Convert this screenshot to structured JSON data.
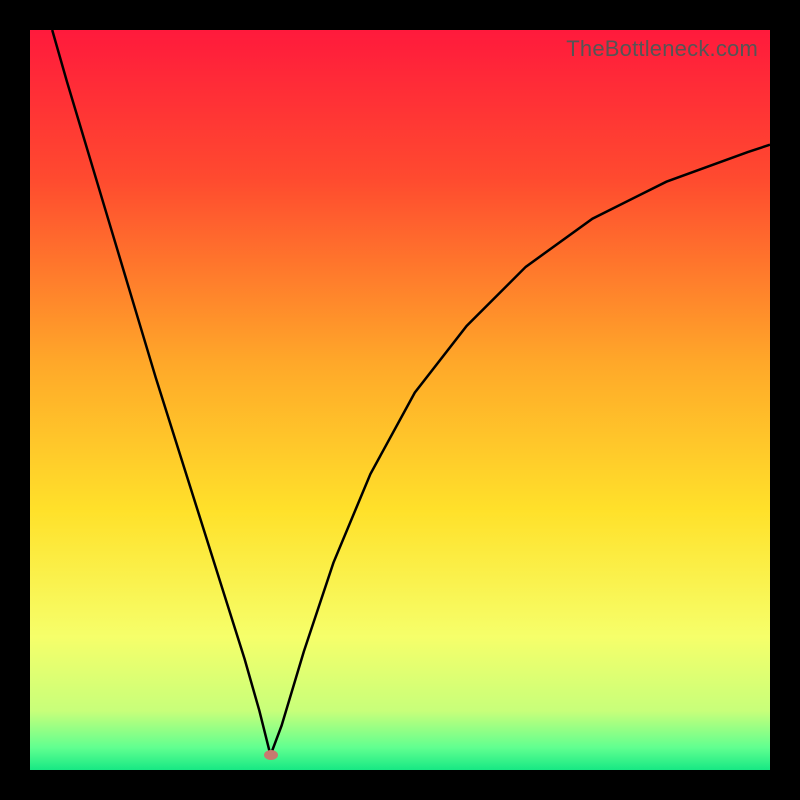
{
  "watermark": "TheBottleneck.com",
  "chart_data": {
    "type": "line",
    "title": "",
    "xlabel": "",
    "ylabel": "",
    "xlim": [
      0,
      100
    ],
    "ylim": [
      0,
      100
    ],
    "grid": false,
    "legend": false,
    "background_gradient": {
      "stops": [
        {
          "pos": 0.0,
          "color": "#ff1a3c"
        },
        {
          "pos": 0.2,
          "color": "#ff4a2f"
        },
        {
          "pos": 0.45,
          "color": "#ffa829"
        },
        {
          "pos": 0.65,
          "color": "#ffe12a"
        },
        {
          "pos": 0.82,
          "color": "#f6ff6a"
        },
        {
          "pos": 0.92,
          "color": "#c8ff7a"
        },
        {
          "pos": 0.97,
          "color": "#60ff90"
        },
        {
          "pos": 1.0,
          "color": "#17e884"
        }
      ]
    },
    "marker": {
      "x": 32.5,
      "y": 2,
      "color": "#c77a6f"
    },
    "series": [
      {
        "name": "curve",
        "color": "#000000",
        "stroke_width": 2.5,
        "x": [
          3,
          5,
          8,
          11,
          14,
          17,
          20,
          23,
          26,
          29,
          31,
          32.5,
          34,
          37,
          41,
          46,
          52,
          59,
          67,
          76,
          86,
          97,
          100
        ],
        "y": [
          100,
          93,
          83,
          73,
          63,
          53,
          43.5,
          34,
          24.5,
          15,
          8,
          2,
          6,
          16,
          28,
          40,
          51,
          60,
          68,
          74.5,
          79.5,
          83.5,
          84.5
        ]
      }
    ]
  }
}
